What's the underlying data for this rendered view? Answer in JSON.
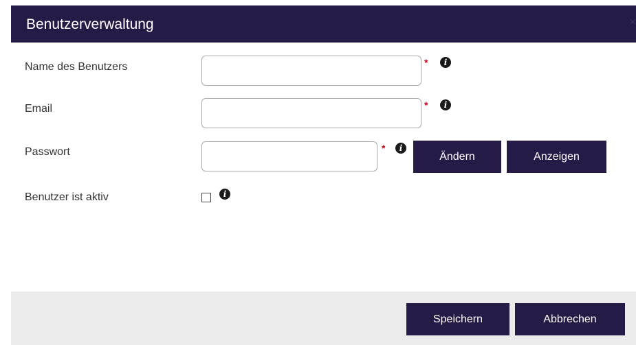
{
  "dialog": {
    "title": "Benutzerverwaltung",
    "close_symbol": "×"
  },
  "form": {
    "name": {
      "label": "Name des Benutzers",
      "value": "",
      "required": true,
      "required_mark": "*"
    },
    "email": {
      "label": "Email",
      "value": "",
      "required": true,
      "required_mark": "*"
    },
    "password": {
      "label": "Passwort",
      "value": "",
      "required": true,
      "required_mark": "*",
      "change_label": "Ändern",
      "show_label": "Anzeigen"
    },
    "active": {
      "label": "Benutzer ist aktiv",
      "checked": false
    },
    "info_glyph": "i"
  },
  "footer": {
    "save_label": "Speichern",
    "cancel_label": "Abbrechen"
  },
  "colors": {
    "primary": "#261b47",
    "required": "#d0021b",
    "footer_bg": "#ebebeb"
  },
  "icons": {
    "info": "info-icon",
    "close": "close-icon"
  }
}
